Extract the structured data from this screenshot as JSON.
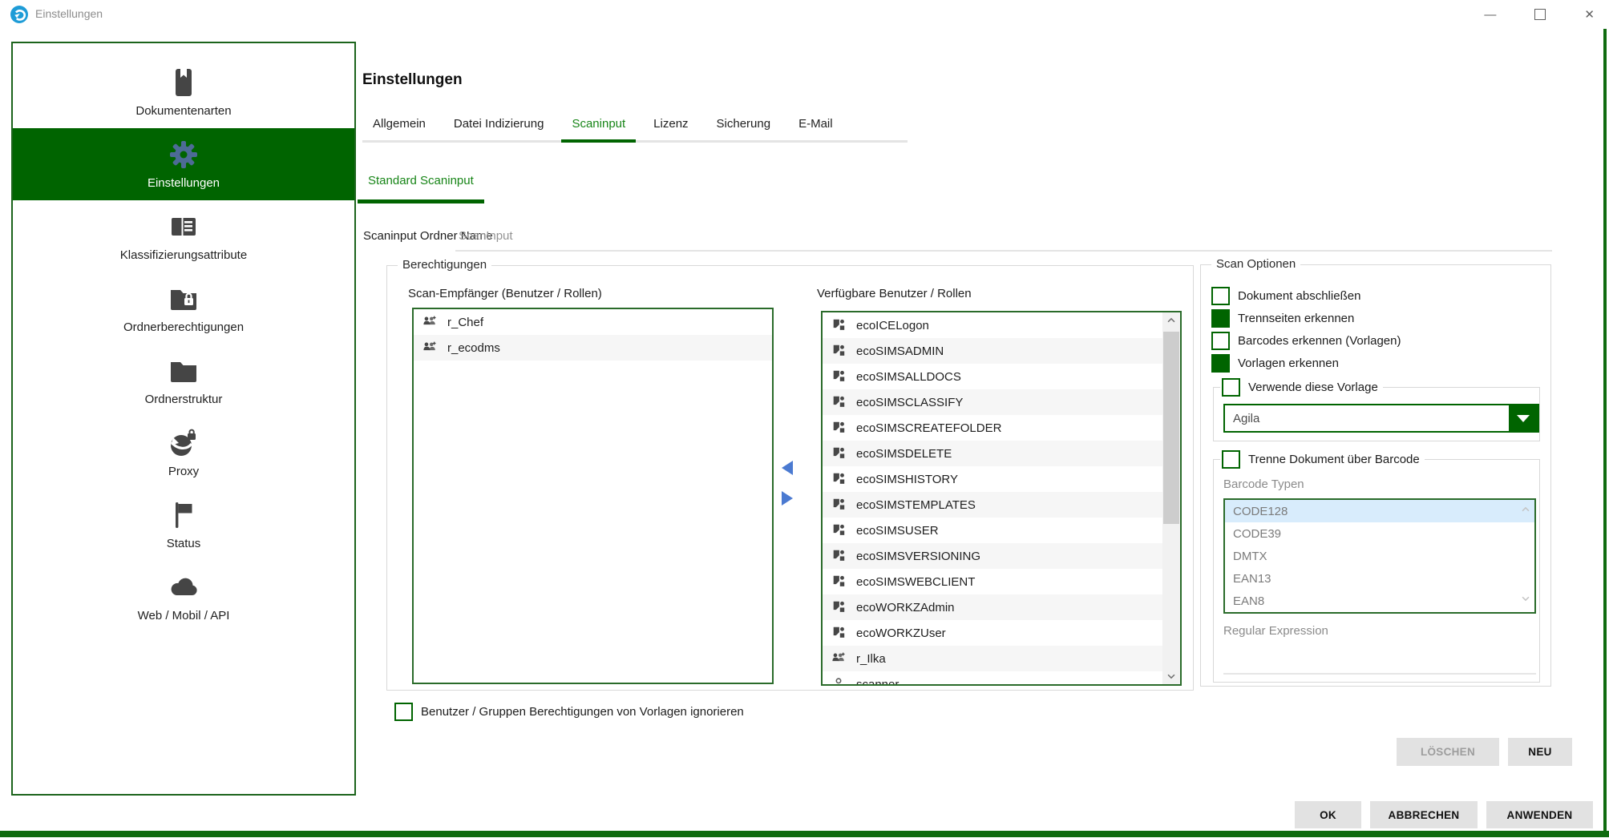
{
  "window": {
    "title": "Einstellungen",
    "controls": {
      "minimize": "—",
      "close": "✕"
    }
  },
  "sidebar": {
    "items": [
      {
        "label": "Dokumentenarten",
        "icon": "book-icon",
        "selected": false
      },
      {
        "label": "Einstellungen",
        "icon": "gear-icon",
        "selected": true
      },
      {
        "label": "Klassifizierungsattribute",
        "icon": "id-card-icon",
        "selected": false
      },
      {
        "label": "Ordnerberechtigungen",
        "icon": "folder-lock-icon",
        "selected": false
      },
      {
        "label": "Ordnerstruktur",
        "icon": "folder-icon",
        "selected": false
      },
      {
        "label": "Proxy",
        "icon": "globe-lock-icon",
        "selected": false
      },
      {
        "label": "Status",
        "icon": "flag-icon",
        "selected": false
      },
      {
        "label": "Web / Mobil / API",
        "icon": "cloud-icon",
        "selected": false
      }
    ]
  },
  "main": {
    "heading": "Einstellungen",
    "tabs": [
      {
        "label": "Allgemein",
        "active": false
      },
      {
        "label": "Datei Indizierung",
        "active": false
      },
      {
        "label": "Scaninput",
        "active": true
      },
      {
        "label": "Lizenz",
        "active": false
      },
      {
        "label": "Sicherung",
        "active": false
      },
      {
        "label": "E-Mail",
        "active": false
      }
    ],
    "subtab": {
      "label": "Standard Scaninput",
      "active": true
    },
    "scaninput_name": {
      "label": "Scaninput Ordner Name",
      "value": "ScanInput"
    },
    "permissions": {
      "group_title": "Berechtigungen",
      "left_title": "Scan-Empfänger (Benutzer / Rollen)",
      "left_items": [
        {
          "name": "r_Chef",
          "icon": "group-icon"
        },
        {
          "name": "r_ecodms",
          "icon": "group-icon"
        }
      ],
      "right_title": "Verfügbare Benutzer / Rollen",
      "right_items": [
        {
          "name": "ecoICELogon",
          "icon": "role-icon"
        },
        {
          "name": "ecoSIMSADMIN",
          "icon": "role-icon"
        },
        {
          "name": "ecoSIMSALLDOCS",
          "icon": "role-icon"
        },
        {
          "name": "ecoSIMSCLASSIFY",
          "icon": "role-icon"
        },
        {
          "name": "ecoSIMSCREATEFOLDER",
          "icon": "role-icon"
        },
        {
          "name": "ecoSIMSDELETE",
          "icon": "role-icon"
        },
        {
          "name": "ecoSIMSHISTORY",
          "icon": "role-icon"
        },
        {
          "name": "ecoSIMSTEMPLATES",
          "icon": "role-icon"
        },
        {
          "name": "ecoSIMSUSER",
          "icon": "role-icon"
        },
        {
          "name": "ecoSIMSVERSIONING",
          "icon": "role-icon"
        },
        {
          "name": "ecoSIMSWEBCLIENT",
          "icon": "role-icon"
        },
        {
          "name": "ecoWORKZAdmin",
          "icon": "role-icon"
        },
        {
          "name": "ecoWORKZUser",
          "icon": "role-icon"
        },
        {
          "name": "r_Ilka",
          "icon": "group-icon"
        },
        {
          "name": "scanner",
          "icon": "user-icon"
        }
      ],
      "ignore_checkbox": {
        "label": "Benutzer / Gruppen Berechtigungen von Vorlagen ignorieren",
        "checked": false
      }
    },
    "scan_options": {
      "group_title": "Scan Optionen",
      "checkboxes": [
        {
          "label": "Dokument abschließen",
          "checked": false
        },
        {
          "label": "Trennseiten erkennen",
          "checked": true
        },
        {
          "label": "Barcodes erkennen (Vorlagen)",
          "checked": false
        },
        {
          "label": "Vorlagen erkennen",
          "checked": true
        }
      ],
      "template_group": {
        "label": "Verwende diese Vorlage",
        "checked": false,
        "dropdown_value": "Agila"
      },
      "barcode_group": {
        "label": "Trenne Dokument über Barcode",
        "checked": false,
        "list_label": "Barcode Typen",
        "items": [
          "CODE128",
          "CODE39",
          "DMTX",
          "EAN13",
          "EAN8"
        ],
        "selected_item": "CODE128",
        "regex_label": "Regular Expression",
        "regex_value": ""
      }
    },
    "buttons": {
      "delete": "LÖSCHEN",
      "new": "NEU",
      "ok": "OK",
      "cancel": "ABBRECHEN",
      "apply": "ANWENDEN"
    }
  },
  "colors": {
    "accent_green": "#006400",
    "tab_green": "#178517",
    "list_border_green": "#2a6b2a",
    "selection_blue": "#d8ecfc",
    "arrow_blue": "#4b7ad1"
  }
}
